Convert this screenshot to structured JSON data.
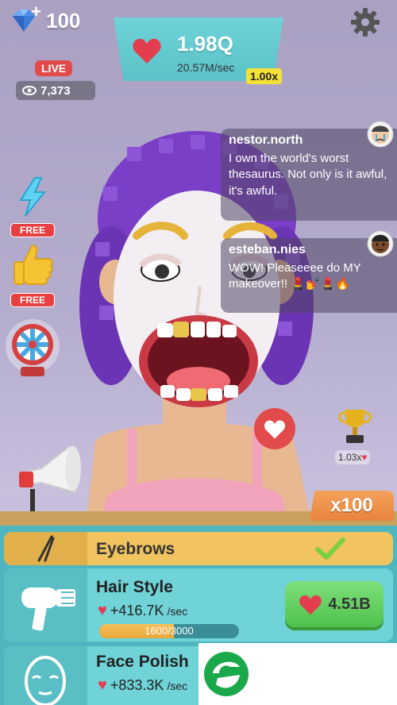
{
  "hud": {
    "gems": "100",
    "love_total": "1.98Q",
    "love_rate": "20.57M/sec",
    "multiplier": "1.00x",
    "live": "LIVE",
    "viewers": "7,373"
  },
  "side": {
    "energy_free": "FREE",
    "like_free": "FREE"
  },
  "chat": [
    {
      "user": "nestor.north",
      "message": "I own the world's worst thesaurus. Not only is it awful, it's awful."
    },
    {
      "user": "esteban.nies",
      "message": "WOW! Pleaseeee do MY makeover!! 💄💅💄🔥"
    }
  ],
  "trophy": {
    "multiplier": "1.03x"
  },
  "shop": {
    "buy_multiplier": "x100",
    "items": [
      {
        "name": "Eyebrows"
      },
      {
        "name": "Hair Style",
        "rate": "+416.7K",
        "per": "/sec",
        "progress_text": "1600/3000",
        "progress_fraction": 0.533,
        "cost": "4.51B"
      },
      {
        "name": "Face Polish",
        "rate": "+833.3K",
        "per": "/sec"
      }
    ]
  },
  "colors": {
    "teal": "#6fd3d8",
    "gold": "#f2c45f",
    "heart_red": "#e43d4d",
    "buy_green": "#5cc95a",
    "hair_purple": "#7a3fc6"
  }
}
